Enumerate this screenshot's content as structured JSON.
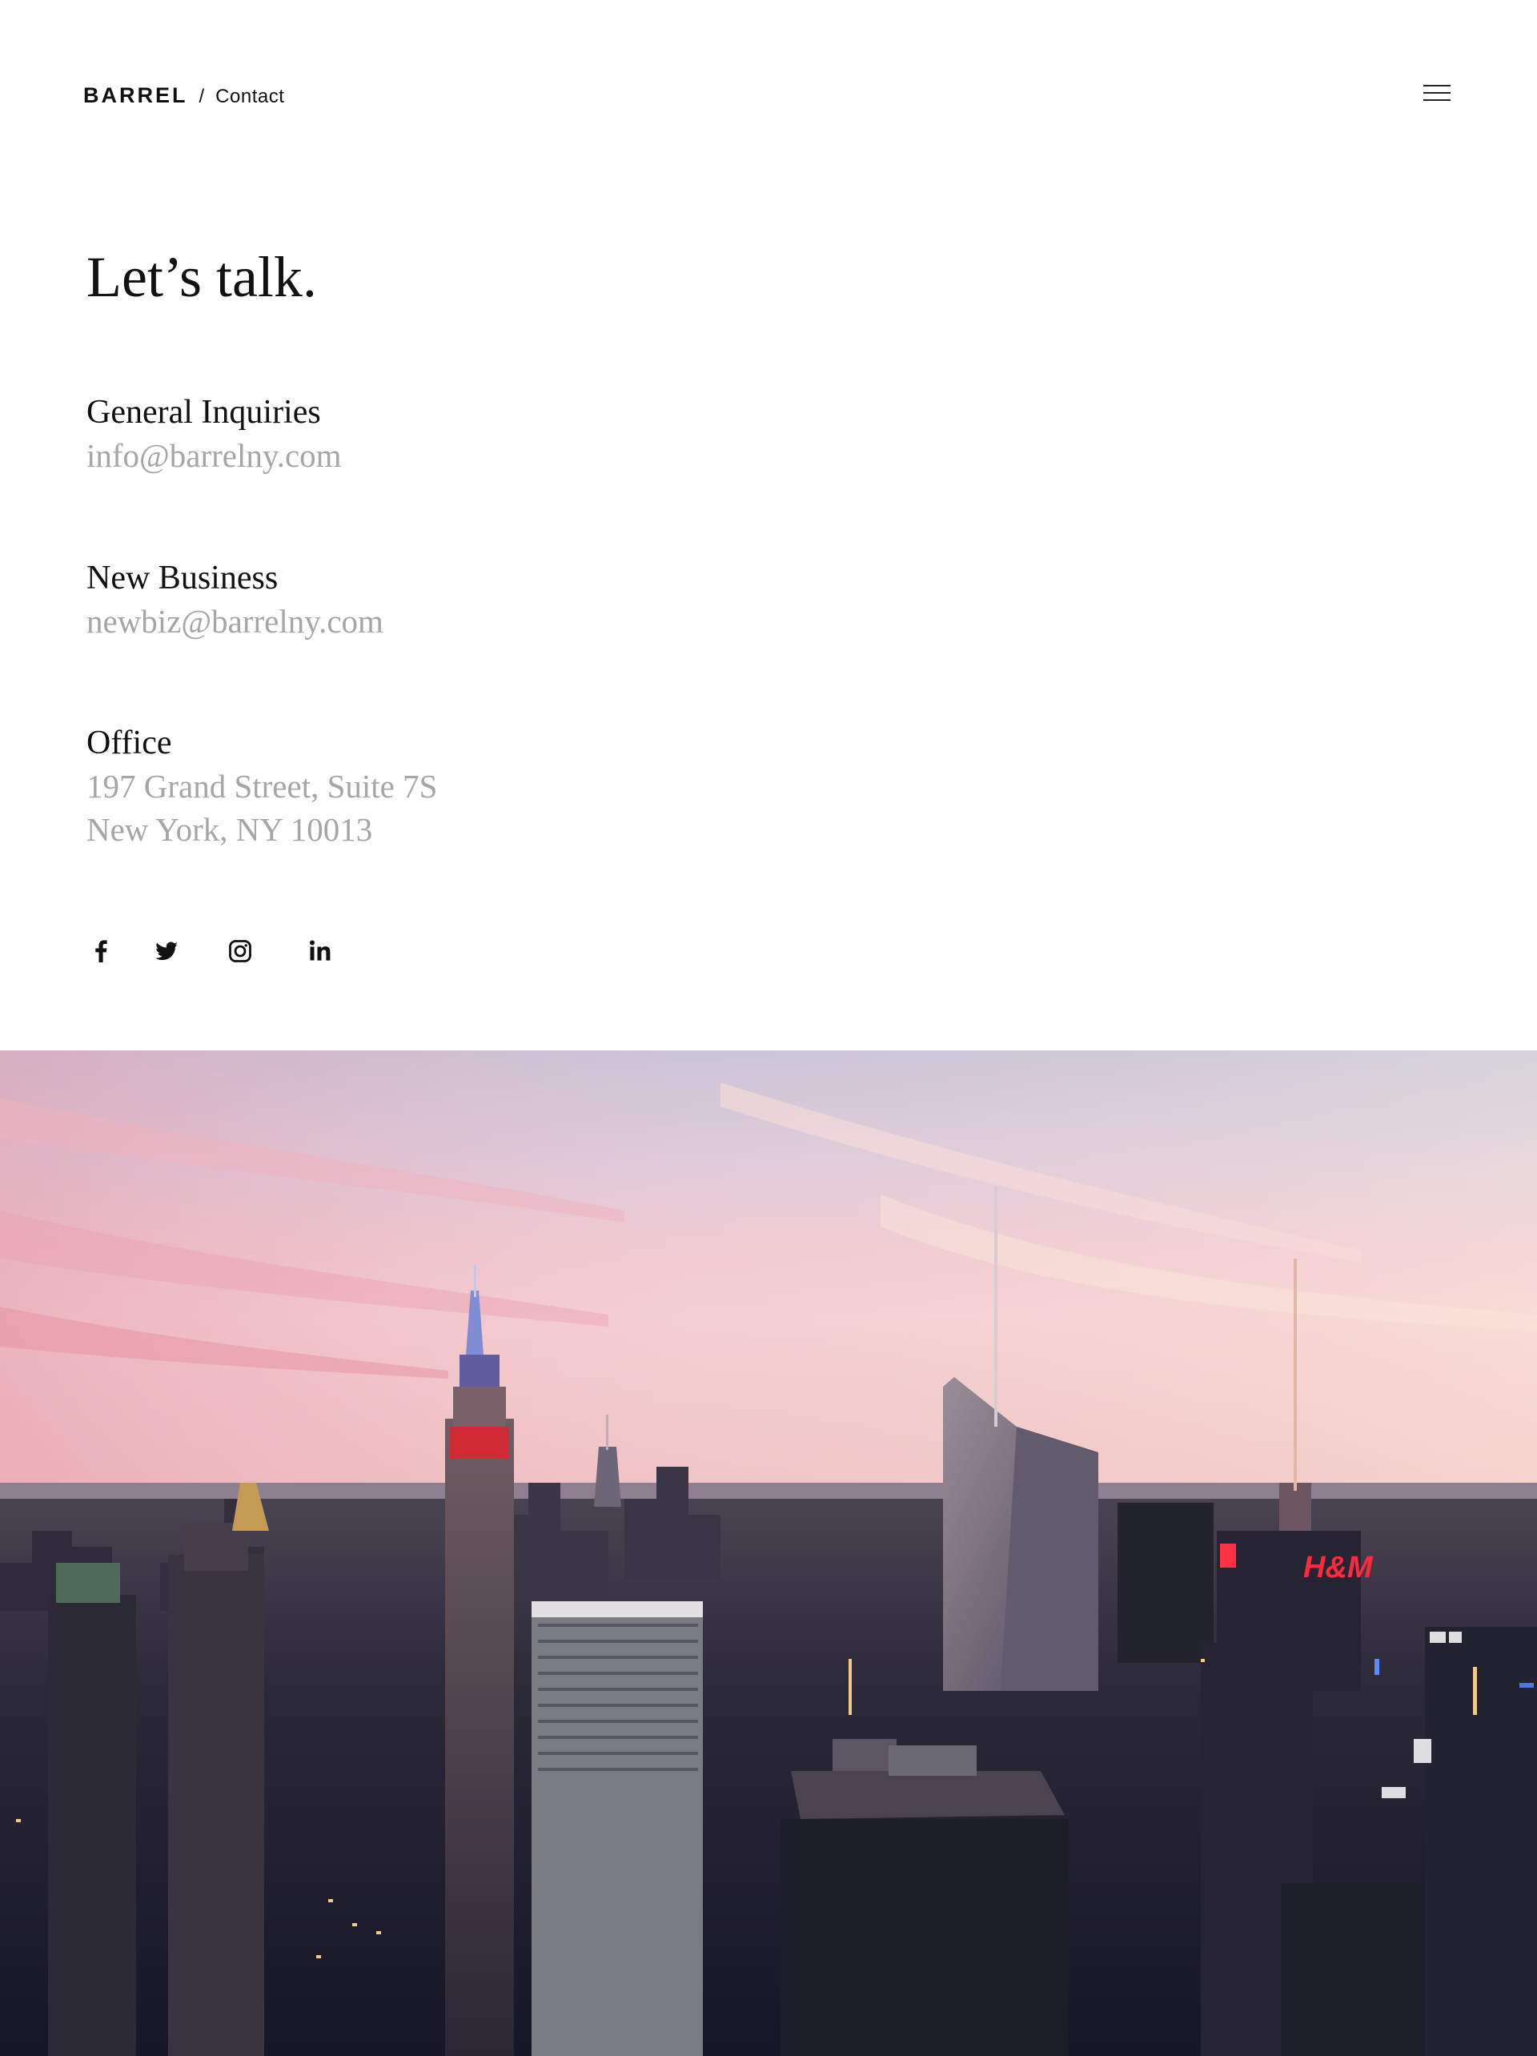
{
  "header": {
    "brand": "BARREL",
    "separator": "/",
    "page": "Contact",
    "menu_icon": "hamburger-menu-icon"
  },
  "main": {
    "headline": "Let’s talk.",
    "general": {
      "title": "General Inquiries",
      "email": "info@barrelny.com"
    },
    "new_business": {
      "title": "New Business",
      "email": "newbiz@barrelny.com"
    },
    "office": {
      "title": "Office",
      "address_line1": "197 Grand Street, Suite 7S",
      "address_line2": "New York, NY 10013"
    },
    "social": [
      {
        "name": "facebook",
        "icon": "facebook-icon"
      },
      {
        "name": "twitter",
        "icon": "twitter-icon"
      },
      {
        "name": "instagram",
        "icon": "instagram-icon"
      },
      {
        "name": "linkedin",
        "icon": "linkedin-icon"
      }
    ]
  },
  "hero": {
    "description_icon": "city-skyline-image",
    "sign": "H&M"
  },
  "colors": {
    "text": "#111111",
    "muted": "#a6a6a6",
    "background": "#ffffff",
    "sky_top": "#b9c3da",
    "sky_pink": "#f2b8c4",
    "city_dark": "#1a1a2a"
  }
}
